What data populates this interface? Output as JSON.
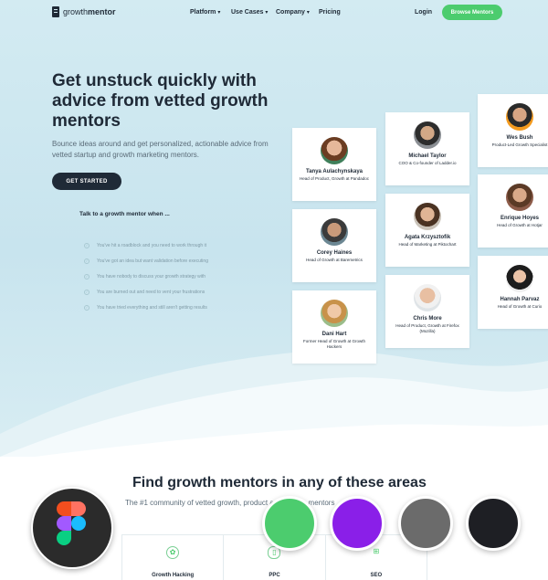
{
  "nav": {
    "logo_light": "growth",
    "logo_bold": "mentor",
    "items": [
      {
        "label": "Platform",
        "dropdown": true
      },
      {
        "label": "Use Cases",
        "dropdown": true
      },
      {
        "label": "Company",
        "dropdown": true
      },
      {
        "label": "Pricing",
        "dropdown": false
      }
    ],
    "login": "Login",
    "browse_button": "Browse Mentors"
  },
  "hero": {
    "headline": "Get unstuck quickly with advice from vetted growth mentors",
    "subtext": "Bounce ideas around and get personalized, actionable advice from vetted startup and growth marketing mentors.",
    "cta": "GET STARTED",
    "talk_title": "Talk to a growth mentor when ...",
    "checklist": [
      "You've hit a roadblock and you need to work through it",
      "You've got an idea but want validation before executing",
      "You have nobody to discuss your growth strategy with",
      "You are burned out and need to vent your frustrations",
      "You have tried everything and still aren't getting results"
    ]
  },
  "mentors": [
    {
      "name": "Tanya Aulachynskaya",
      "role": "Head of Product, Growth at Pandadoc"
    },
    {
      "name": "Corey Haines",
      "role": "Head of Growth at Baremetrics"
    },
    {
      "name": "Dani Hart",
      "role": "Former Head of Growth at Growth Hackers"
    },
    {
      "name": "Michael Taylor",
      "role": "COO & Co-founder of Ladder.io"
    },
    {
      "name": "Agata Krzysztofik",
      "role": "Head of Marketing at Piktochart"
    },
    {
      "name": "Chris More",
      "role": "Head of Product, Growth at Firefox (Mozilla)"
    },
    {
      "name": "Wes Bush",
      "role": "Product-Led Growth Specialist"
    },
    {
      "name": "Enrique Hoyes",
      "role": "Head of Growth at Hotjar"
    },
    {
      "name": "Hannah Parvaz",
      "role": "Head of Growth at Curio"
    }
  ],
  "areas": {
    "title": "Find growth mentors in any of these areas",
    "subtitle": "The #1 community of vetted growth, product and startup mentors",
    "items": [
      {
        "label": "Growth Hacking",
        "icon": "plant-icon"
      },
      {
        "label": "PPC",
        "icon": "mouse-icon"
      },
      {
        "label": "SEO",
        "icon": "sitemap-icon"
      }
    ]
  },
  "overlay": {
    "figma_colors": [
      "#f24e1e",
      "#a259ff",
      "#1abcfe",
      "#0acf83",
      "#ff7262"
    ],
    "swatches": [
      "#4ccc6e",
      "#8a1fe8",
      "#6b6b6b",
      "#1e1f24"
    ]
  }
}
